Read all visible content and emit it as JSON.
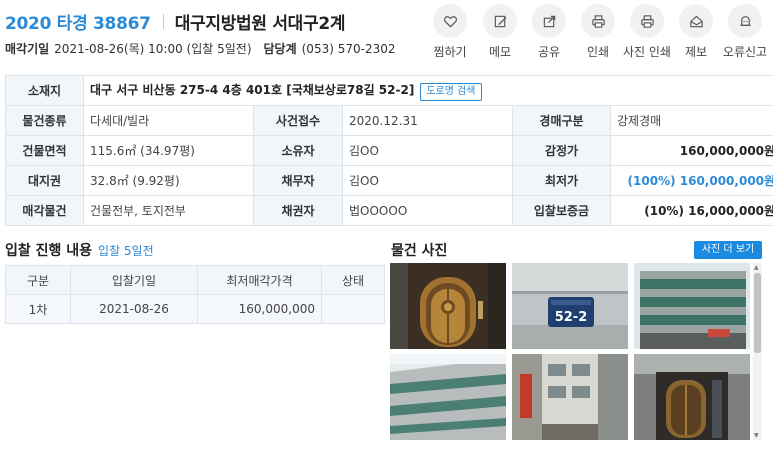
{
  "header": {
    "case_no": "2020 타경 38867",
    "court": "대구지방법원 서대구2계",
    "sale_date_label": "매각기일",
    "sale_date_value": "2021-08-26(목) 10:00 (입찰 5일전)",
    "dept_label": "담당계",
    "dept_value": "(053) 570-2302"
  },
  "actions": [
    {
      "label": "찜하기",
      "icon": "heart-icon"
    },
    {
      "label": "메모",
      "icon": "memo-icon"
    },
    {
      "label": "공유",
      "icon": "share-icon"
    },
    {
      "label": "인쇄",
      "icon": "print-icon"
    },
    {
      "label": "사진 인쇄",
      "icon": "photo-print-icon"
    },
    {
      "label": "제보",
      "icon": "report-icon"
    },
    {
      "label": "오류신고",
      "icon": "bell-icon"
    }
  ],
  "info": {
    "location_label": "소재지",
    "location_value": "대구 서구 비산동 275-4 4층 401호 [국채보상로78길 52-2]",
    "road_search": "도로명 검색",
    "rows": [
      {
        "l1": "물건종류",
        "v1": "다세대/빌라",
        "l2": "사건접수",
        "v2": "2020.12.31",
        "l3": "경매구분",
        "v3": "강제경매"
      },
      {
        "l1": "건물면적",
        "v1": "115.6㎡ (34.97평)",
        "l2": "소유자",
        "v2": "김OO",
        "l3": "감정가",
        "v3": "160,000,000원"
      },
      {
        "l1": "대지권",
        "v1": "32.8㎡ (9.92평)",
        "l2": "채무자",
        "v2": "김OO",
        "l3": "최저가",
        "v3": "(100%) 160,000,000원"
      },
      {
        "l1": "매각물건",
        "v1": "건물전부, 토지전부",
        "l2": "채권자",
        "v2": "법OOOOO",
        "l3": "입찰보증금",
        "v3": "(10%) 16,000,000원"
      }
    ]
  },
  "bid": {
    "title": "입찰 진행 내용",
    "sub": "입찰 5일전",
    "headers": [
      "구분",
      "입찰기일",
      "최저매각가격",
      "상태"
    ],
    "rows": [
      {
        "round": "1차",
        "date": "2021-08-26",
        "price": "160,000,000",
        "status": ""
      }
    ]
  },
  "photos": {
    "title": "물건 사진",
    "more": "사진 더 보기",
    "sign_text": "52-2"
  },
  "colors": {
    "accent": "#2d8ad6",
    "button": "#1a8be0",
    "header_bg": "#f1f6fa",
    "border": "#dde3e8"
  }
}
